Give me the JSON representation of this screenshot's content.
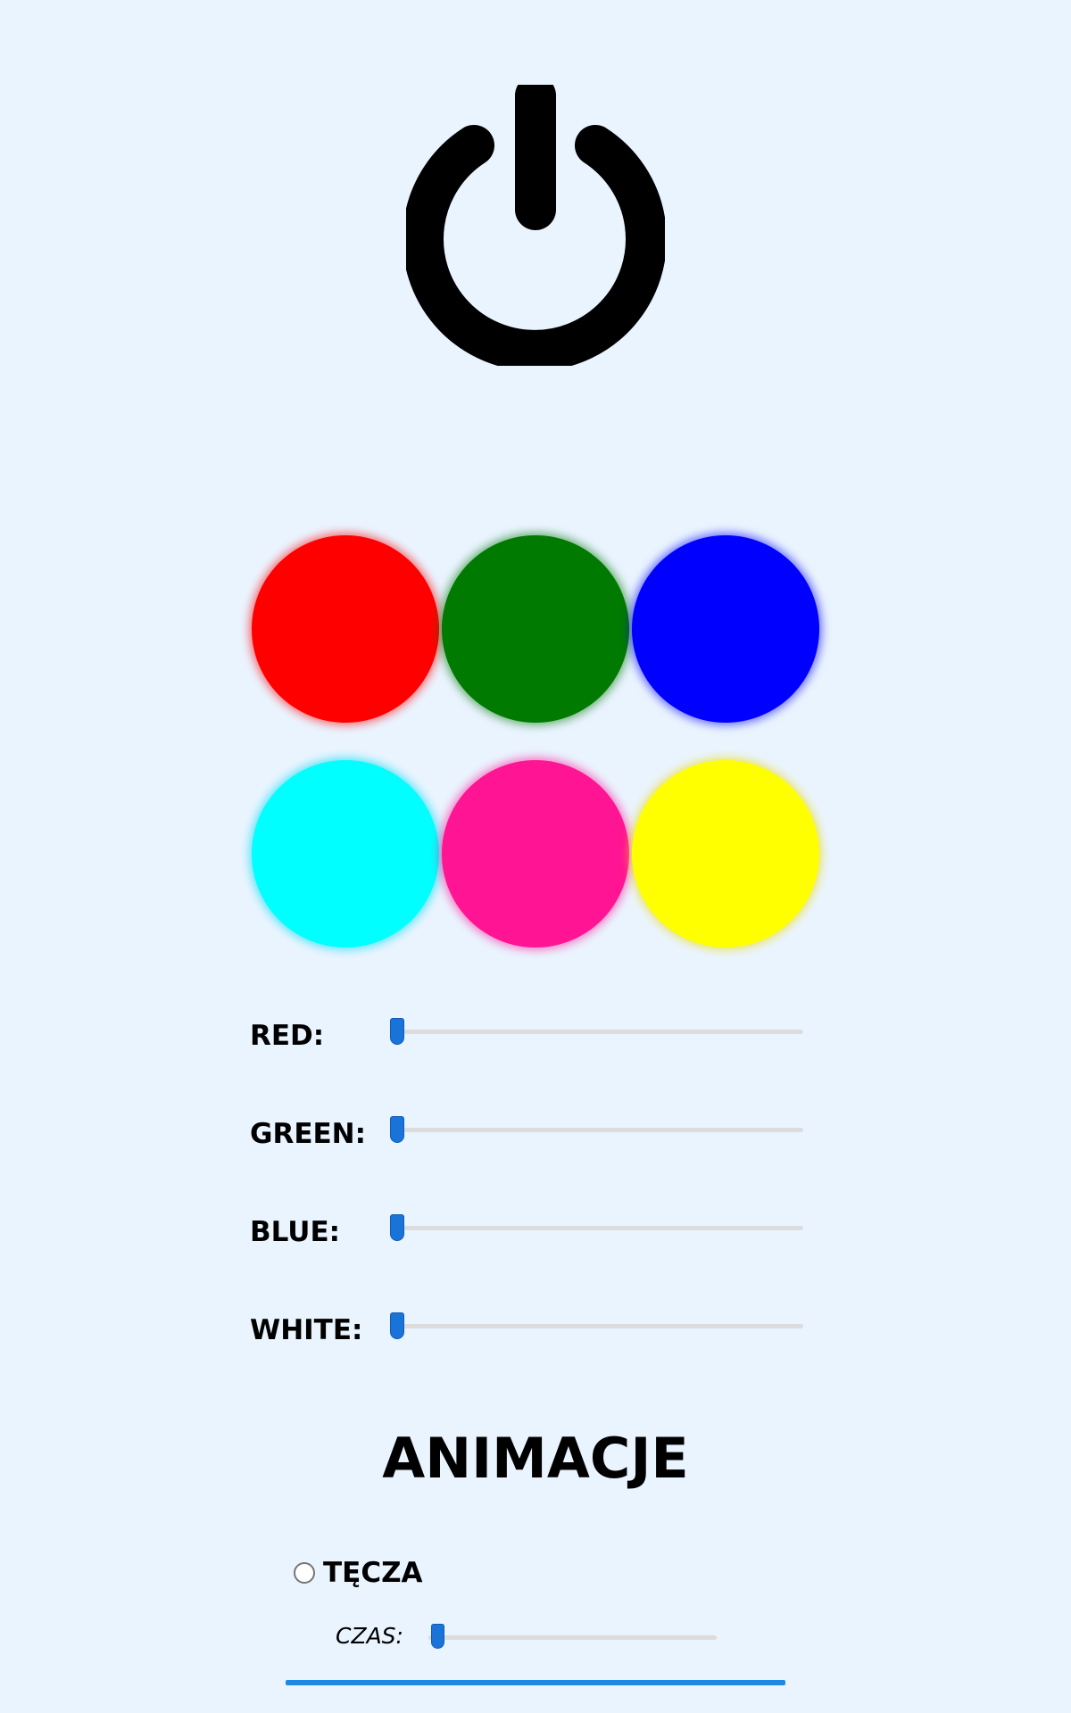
{
  "power": {
    "icon": "power-icon",
    "color": "#000000"
  },
  "swatches": [
    {
      "name": "red",
      "color": "#ff0000"
    },
    {
      "name": "green",
      "color": "#007a00"
    },
    {
      "name": "blue",
      "color": "#0000ff"
    },
    {
      "name": "cyan",
      "color": "#00ffff"
    },
    {
      "name": "pink",
      "color": "#ff1493"
    },
    {
      "name": "yellow",
      "color": "#ffff00"
    }
  ],
  "sliders": [
    {
      "label": "RED:",
      "value": 0
    },
    {
      "label": "GREEN:",
      "value": 0
    },
    {
      "label": "BLUE:",
      "value": 0
    },
    {
      "label": "WHITE:",
      "value": 0
    }
  ],
  "animations": {
    "title": "ANIMACJE",
    "rainbow": {
      "label": "TĘCZA",
      "checked": false
    },
    "time": {
      "label": "CZAS:",
      "value": 0
    }
  },
  "colors": {
    "background": "#eaf4ff",
    "accent": "#1e88e5",
    "slider_thumb": "#1a73d9",
    "slider_track": "#dcdcdc"
  }
}
